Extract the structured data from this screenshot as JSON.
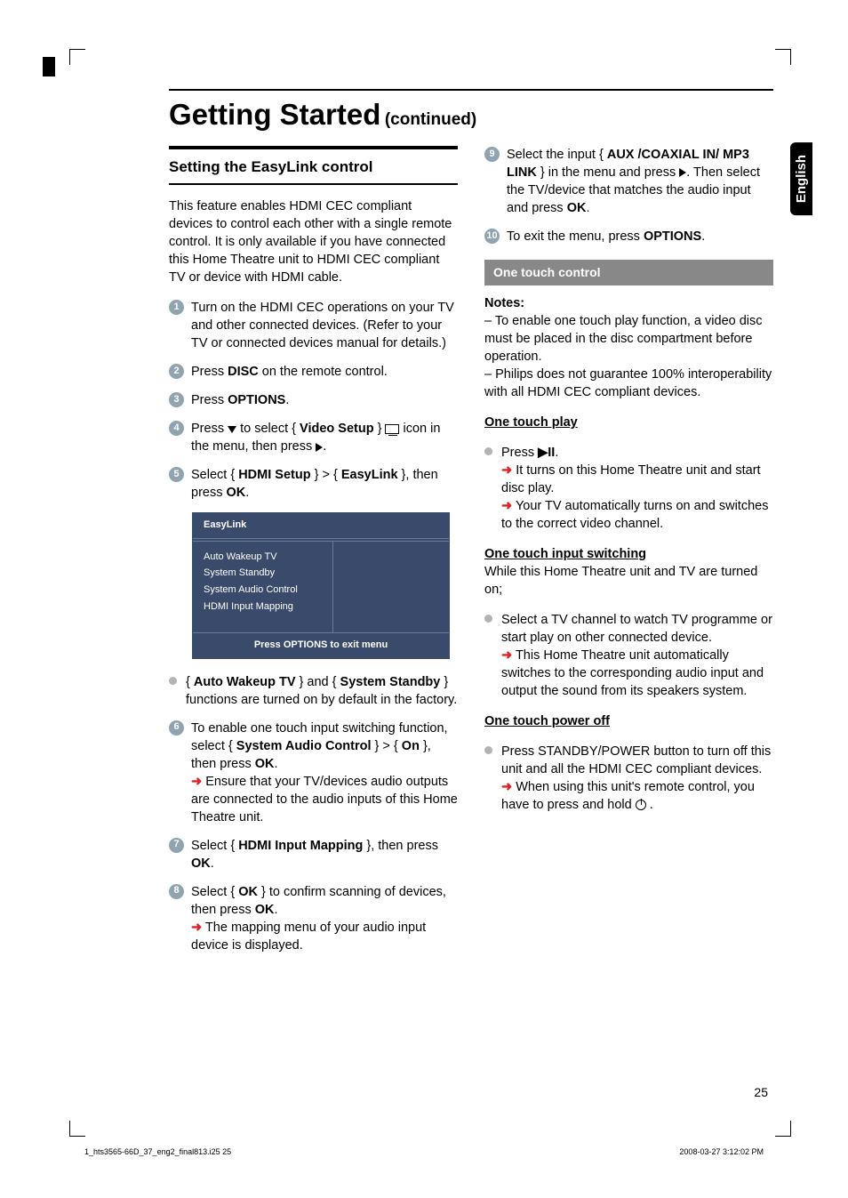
{
  "header": {
    "main_title": "Getting Started",
    "continued": "(continued)"
  },
  "lang_tab": "English",
  "section_title": "Setting the EasyLink control",
  "intro": "This feature enables HDMI CEC compliant devices to control each other with a single remote control. It is only available if you have connected this Home Theatre unit to HDMI CEC compliant TV or device with HDMI cable.",
  "steps": {
    "s1": "Turn on the HDMI CEC operations on your TV and other connected devices. (Refer to your TV or connected devices manual for details.)",
    "s2_a": "Press ",
    "s2_b": "DISC",
    "s2_c": " on the remote control.",
    "s3_a": "Press ",
    "s3_b": "OPTIONS",
    "s3_c": ".",
    "s4_a": "Press ",
    "s4_b": " to select  { ",
    "s4_c": "Video Setup",
    "s4_d": " } ",
    "s4_e": " icon in the menu, then press ",
    "s4_f": ".",
    "s5_a": "Select { ",
    "s5_b": "HDMI Setup",
    "s5_c": " } > { ",
    "s5_d": "EasyLink",
    "s5_e": " }, then press ",
    "s5_f": "OK",
    "s5_g": ".",
    "s6_a": "To enable one touch input switching function, select { ",
    "s6_b": "System Audio Control",
    "s6_c": " } > { ",
    "s6_d": "On",
    "s6_e": " }, then press ",
    "s6_f": "OK",
    "s6_g": ".",
    "s6_h": "Ensure that your TV/devices audio outputs are connected to the audio inputs of this Home Theatre unit.",
    "s7_a": "Select { ",
    "s7_b": "HDMI Input Mapping",
    "s7_c": " }, then press ",
    "s7_d": "OK",
    "s7_e": ".",
    "s8_a": "Select { ",
    "s8_b": "OK",
    "s8_c": " } to confirm scanning of devices, then press ",
    "s8_d": "OK",
    "s8_e": ".",
    "s8_f": "The mapping menu of your audio input device is displayed.",
    "s9_a": "Select the input { ",
    "s9_b": "AUX /COAXIAL IN/ MP3 LINK",
    "s9_c": " } in the menu and press ",
    "s9_d": ". Then select the TV/device that matches the audio input and press ",
    "s9_e": "OK",
    "s9_f": ".",
    "s10_a": "To exit the menu, press ",
    "s10_b": "OPTIONS",
    "s10_c": "."
  },
  "bullet1_a": "{ ",
  "bullet1_b": "Auto Wakeup TV",
  "bullet1_c": " } and { ",
  "bullet1_d": "System Standby",
  "bullet1_e": " } functions are turned on by default in the factory.",
  "menu": {
    "title": "EasyLink",
    "items": [
      "Auto Wakeup TV",
      "System Standby",
      "System Audio Control",
      "HDMI Input Mapping"
    ],
    "footer": "Press OPTIONS to exit menu"
  },
  "grey_heading": "One touch control",
  "notes_label": "Notes:",
  "notes": [
    "–  To enable one touch play function, a video disc must be placed in the disc compartment before operation.",
    "–  Philips does not guarantee 100% interoperability with all HDMI CEC compliant devices."
  ],
  "otp_heading": "One touch play",
  "otp_press": "Press ",
  "otp_r1": "It turns on this Home Theatre unit and start disc play.",
  "otp_r2": "Your TV automatically turns on and switches to the correct video channel.",
  "otis_heading": "One touch input switching",
  "otis_line": "While this Home Theatre unit and TV are turned on;",
  "otis_bullet": "Select a TV channel to watch TV programme or start play on other connected device.",
  "otis_r": "This Home Theatre unit automatically switches to the corresponding audio input and output the sound from its speakers system.",
  "otpo_heading": "One touch power off",
  "otpo_bullet": "Press STANDBY/POWER button to turn off this unit and all the HDMI CEC compliant devices.",
  "otpo_r": "When using this unit's remote control, you have to press and hold ",
  "page_number": "25",
  "footer_left": "1_hts3565-66D_37_eng2_final813.i25   25",
  "footer_right": "2008-03-27   3:12:02 PM"
}
